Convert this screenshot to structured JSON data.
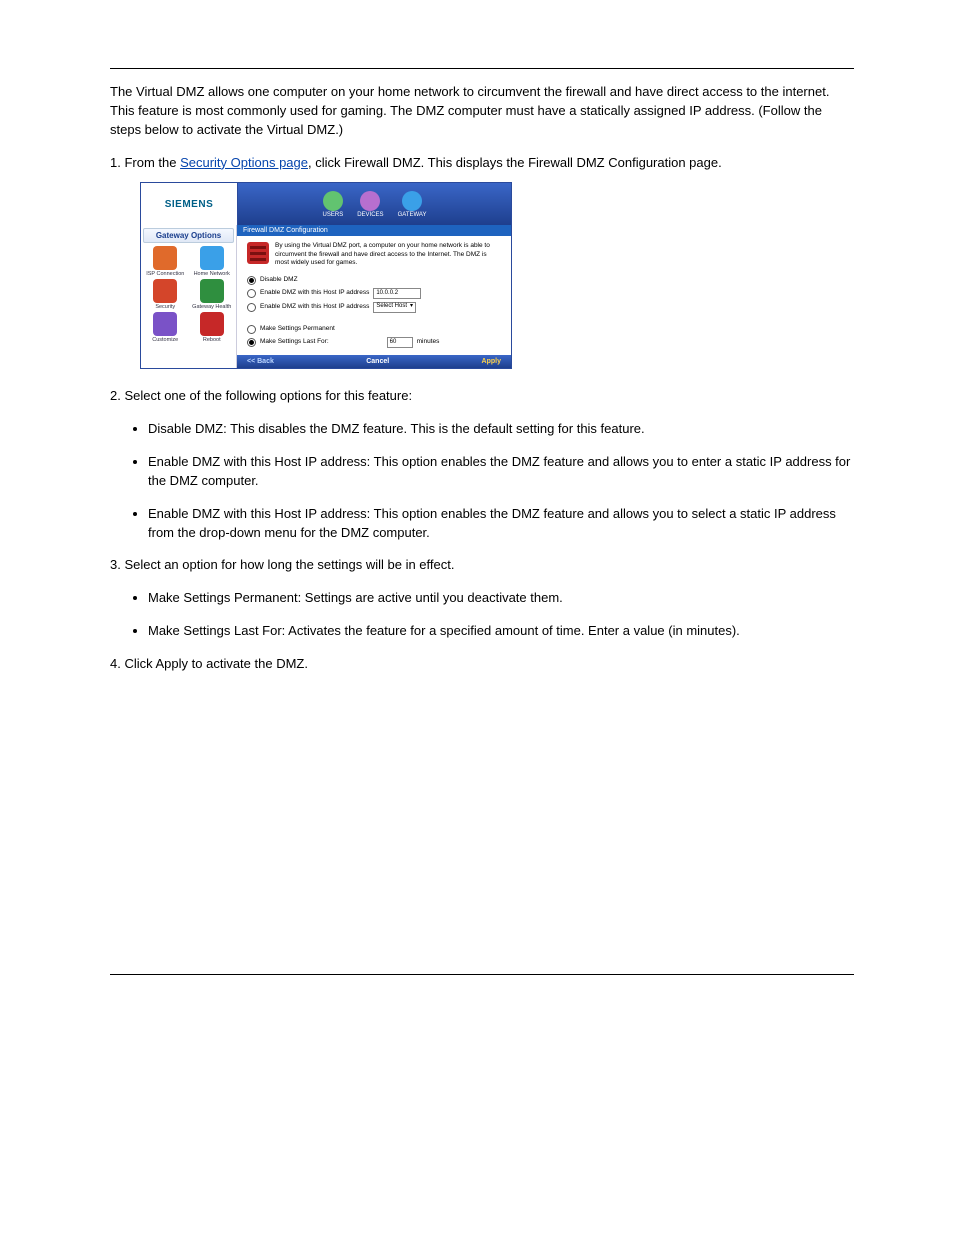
{
  "header": {
    "left_chapter": "",
    "right_title": ""
  },
  "intro_para": "The Virtual DMZ allows one computer on your home network to circumvent the firewall and have direct access to the internet. This feature is most commonly used for gaming. The DMZ computer must have a statically assigned IP address. (Follow the steps below to activate the Virtual DMZ.)",
  "step1": {
    "prefix": "1. From the ",
    "link": "Security Options page",
    "suffix": ", click Firewall DMZ. This displays the Firewall DMZ Configuration page."
  },
  "step2": "2. Select one of the following options for this feature:",
  "bullets_a": [
    "Disable DMZ: This disables the DMZ feature. This is the default setting for this feature.",
    "Enable DMZ with this Host IP address: This option enables the DMZ feature and allows you to enter a static IP address for the DMZ computer.",
    "Enable DMZ with this Host IP address: This option enables the DMZ feature and allows you to select a static IP address from the drop-down menu for the DMZ computer."
  ],
  "step3": "3. Select an option for how long the settings will be in effect.",
  "bullets_b": [
    "Make Settings Permanent: Settings are active until you deactivate them.",
    "Make Settings Last For: Activates the feature for a specified amount of time. Enter a value (in minutes)."
  ],
  "step4": "4. Click Apply to activate the DMZ.",
  "footer": {
    "left": "",
    "right": ""
  },
  "shot": {
    "logo": "SIEMENS",
    "nav": [
      {
        "label": "USERS",
        "color": "#62c370"
      },
      {
        "label": "DEVICES",
        "color": "#b76fcf"
      },
      {
        "label": "GATEWAY",
        "color": "#3aa0e8"
      }
    ],
    "sidebar_title": "Gateway Options",
    "gw": [
      {
        "label": "ISP Connection",
        "color": "#e06a2b"
      },
      {
        "label": "Home Network",
        "color": "#3aa0e8"
      },
      {
        "label": "Security",
        "color": "#d4452a"
      },
      {
        "label": "Gateway Health",
        "color": "#2f8f3f"
      },
      {
        "label": "Customize",
        "color": "#7a52c7"
      },
      {
        "label": "Reboot",
        "color": "#c62828"
      }
    ],
    "pane_title": "Firewall DMZ Configuration",
    "intro": "By using the Virtual DMZ port, a computer on your home network is able to circumvent the firewall and have direct access to the Internet. The DMZ is most widely used for games.",
    "opt_disable": "Disable DMZ",
    "opt_enable_ip_label": "Enable DMZ with this Host IP address",
    "opt_enable_ip_value": "10.0.0.2",
    "opt_enable_host_label": "Enable DMZ with this Host IP address",
    "opt_enable_host_value": "Select Host",
    "perm_label": "Make Settings Permanent",
    "lastfor_label": "Make Settings Last For:",
    "lastfor_value": "60",
    "lastfor_unit": "minutes",
    "back": "<< Back",
    "cancel": "Cancel",
    "apply": "Apply"
  }
}
